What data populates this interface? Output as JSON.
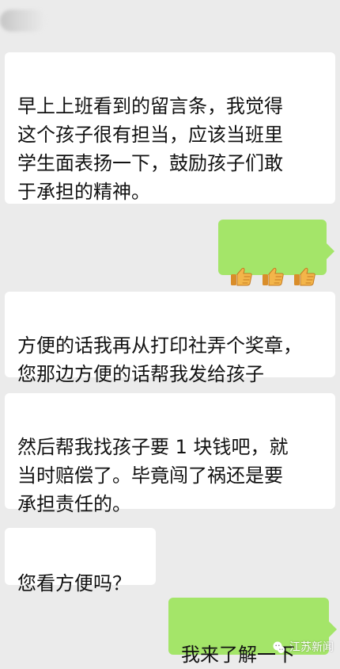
{
  "chat": {
    "messages": [
      {
        "side": "incoming",
        "text": "早上上班看到的留言条，我觉得\n这个孩子很有担当，应该当班里\n学生面表扬一下，鼓励孩子们敢\n于承担的精神。"
      },
      {
        "side": "outgoing",
        "icons": [
          "thumbs-up-icon",
          "thumbs-up-icon",
          "thumbs-up-icon"
        ]
      },
      {
        "side": "incoming",
        "text": "方便的话我再从打印社弄个奖章，\n您那边方便的话帮我发给孩子"
      },
      {
        "side": "incoming",
        "text": "然后帮我找孩子要 1 块钱吧，就\n当时赔偿了。毕竟闯了祸还是要\n承担责任的。"
      },
      {
        "side": "incoming",
        "text": "您看方便吗？"
      },
      {
        "side": "outgoing",
        "text": "我来了解一下"
      }
    ]
  },
  "watermark": {
    "text": "江苏新闻",
    "icon": "wechat-icon"
  },
  "colors": {
    "background": "#ebebeb",
    "incoming_bubble": "#ffffff",
    "outgoing_bubble": "#a4e569",
    "thumb": "#f3b54a"
  }
}
